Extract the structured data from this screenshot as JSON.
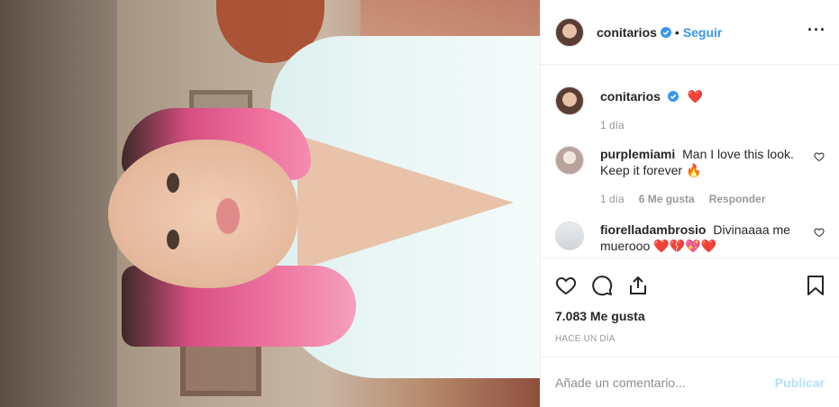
{
  "post": {
    "author": "conitarios",
    "follow_label": "Seguir",
    "separator": "•",
    "more_icon": "more-horizontal-icon",
    "caption_emoji": "❤️",
    "caption_time": "1 día"
  },
  "comments": [
    {
      "user": "purplemiami",
      "text": "Man I love this look. Keep it forever 🔥",
      "time": "1 día",
      "likes": "6 Me gusta",
      "reply": "Responder"
    },
    {
      "user": "fiorelladambrosio",
      "text": "Divinaaaa me muerooo ❤️💔💖❤️",
      "time": "",
      "likes": "",
      "reply": ""
    }
  ],
  "actions": {
    "like_icon": "heart-icon",
    "comment_icon": "comment-icon",
    "share_icon": "share-icon",
    "save_icon": "bookmark-icon"
  },
  "likes_count": "7.083 Me gusta",
  "posted_ago": "HACE UN DÍA",
  "add_comment": {
    "placeholder": "Añade un comentario...",
    "publish_label": "Publicar"
  },
  "colors": {
    "link_blue": "#3897f0",
    "publish_disabled": "#b2dffc",
    "muted": "#999999",
    "verified": "#3897f0"
  }
}
